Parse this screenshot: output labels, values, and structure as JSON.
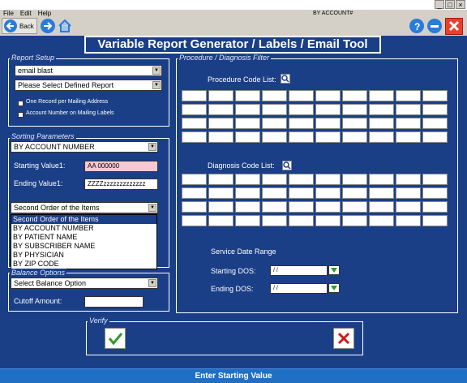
{
  "window": {
    "minimize": "_",
    "maximize": "□",
    "close": "×"
  },
  "menu": {
    "items": [
      "File",
      "Edit",
      "Help"
    ],
    "account_label": "BY ACCOUNT#"
  },
  "toolbar": {
    "back_label": "Back"
  },
  "header": {
    "title": "Variable Report Generator / Labels / Email Tool"
  },
  "report_setup": {
    "legend": "Report Setup",
    "type_value": "email blast",
    "defined_report_value": "Please Select Defined Report",
    "check1_label": "One Record per Mailing Address",
    "check2_label": "Account Number on Mailing Labels"
  },
  "sorting": {
    "legend": "Sorting Parameters",
    "sort_value": "BY ACCOUNT NUMBER",
    "starting_label": "Starting Value1:",
    "starting_value": "AA        000000",
    "ending_label": "Ending   Value1:",
    "ending_value": "ZZZZzzzzzzzzzzzzz",
    "second_order_value": "Second Order of the Items",
    "options": [
      "Second Order of the Items",
      "BY ACCOUNT NUMBER",
      "BY PATIENT NAME",
      "BY SUBSCRIBER NAME",
      "BY PHYSICIAN",
      "BY ZIP CODE"
    ]
  },
  "balance": {
    "legend": "Balance Options",
    "select_value": "Select Balance Option",
    "cutoff_label": "Cutoff Amount:",
    "cutoff_value": ""
  },
  "filter": {
    "legend": "Procedure / Diagnosis Filter",
    "procedure_label": "Procedure Code List:",
    "diagnosis_label": "Diagnosis Code List:",
    "service_label": "Service Date Range",
    "start_dos_label": "Starting DOS:",
    "start_dos_value": " / /",
    "end_dos_label": "Ending   DOS:",
    "end_dos_value": " / /"
  },
  "verify": {
    "legend": "Verify"
  },
  "status": {
    "text": "Enter Starting Value"
  },
  "colors": {
    "background": "#1b3f86",
    "status_bar": "#1f6fc4",
    "input_highlight": "#f6c8d2",
    "verify_ok": "#2e9a2e",
    "verify_cancel": "#cc1b1b"
  }
}
